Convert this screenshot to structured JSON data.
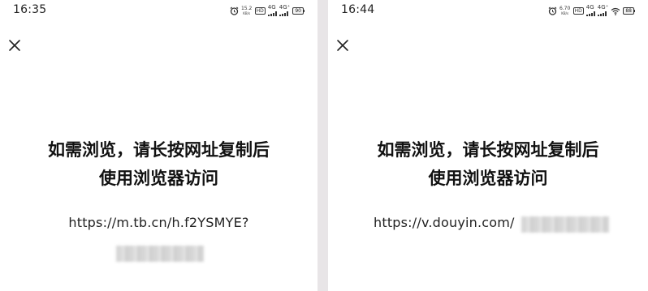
{
  "left": {
    "time": "16:35",
    "speed": "15.2",
    "speed_unit": "KB/s",
    "hd": "HD",
    "net1": "4G",
    "net2": "4G⁺",
    "battery": "90",
    "message_line1": "如需浏览，请长按网址复制后",
    "message_line2": "使用浏览器访问",
    "url": "https://m.tb.cn/h.f2YSMYE?"
  },
  "right": {
    "time": "16:44",
    "speed": "6.70",
    "speed_unit": "KB/s",
    "hd": "HD",
    "net1": "4G",
    "net2": "4G⁺",
    "battery": "88",
    "message_line1": "如需浏览，请长按网址复制后",
    "message_line2": "使用浏览器访问",
    "url": "https://v.douyin.com/"
  },
  "icons": {
    "alarm": "alarm-icon",
    "close": "close-icon",
    "wifi": "wifi-icon",
    "signal": "signal-icon",
    "battery": "battery-icon"
  },
  "colors": {
    "background": "#ffffff",
    "divider": "#e8e5e7",
    "text": "#111111"
  }
}
